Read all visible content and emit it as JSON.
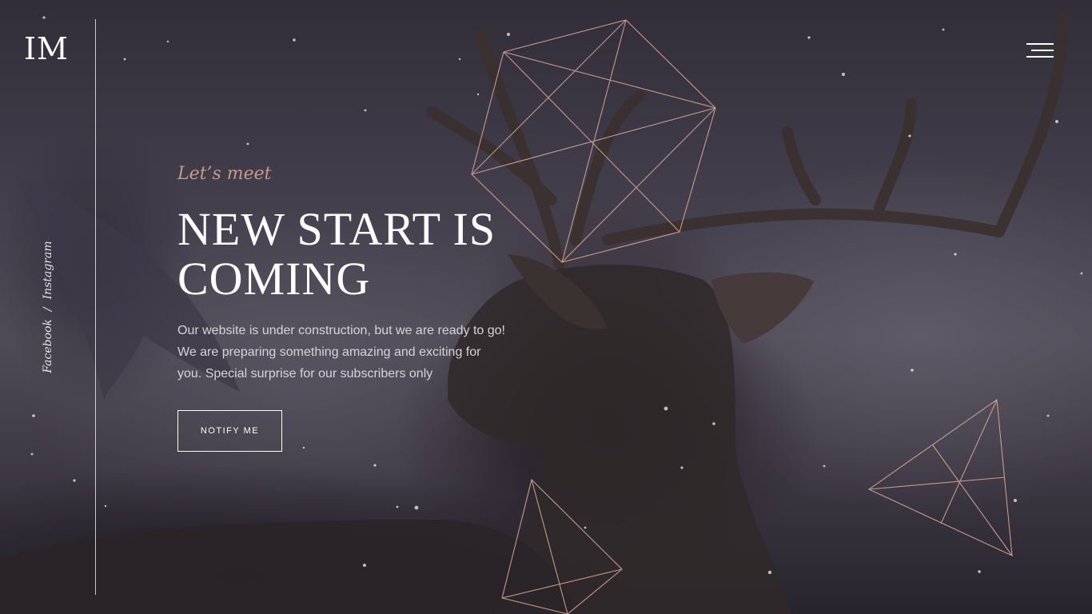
{
  "brand": {
    "logo_text": "IM"
  },
  "social": {
    "facebook": "Facebook",
    "separator": "/",
    "instagram": "Instagram"
  },
  "nav": {
    "menu_icon": "hamburger-menu-icon"
  },
  "hero": {
    "kicker": "Let’s meet",
    "title": "NEW START IS COMING",
    "description": "Our website is under construction, but we are ready to go! We are preparing something amazing and exciting for you. Special surprise for our subscribers only",
    "cta_label": "NOTIFY ME"
  },
  "colors": {
    "accent": "#c79a88",
    "text": "#ffffff",
    "line": "#d9a58f"
  }
}
